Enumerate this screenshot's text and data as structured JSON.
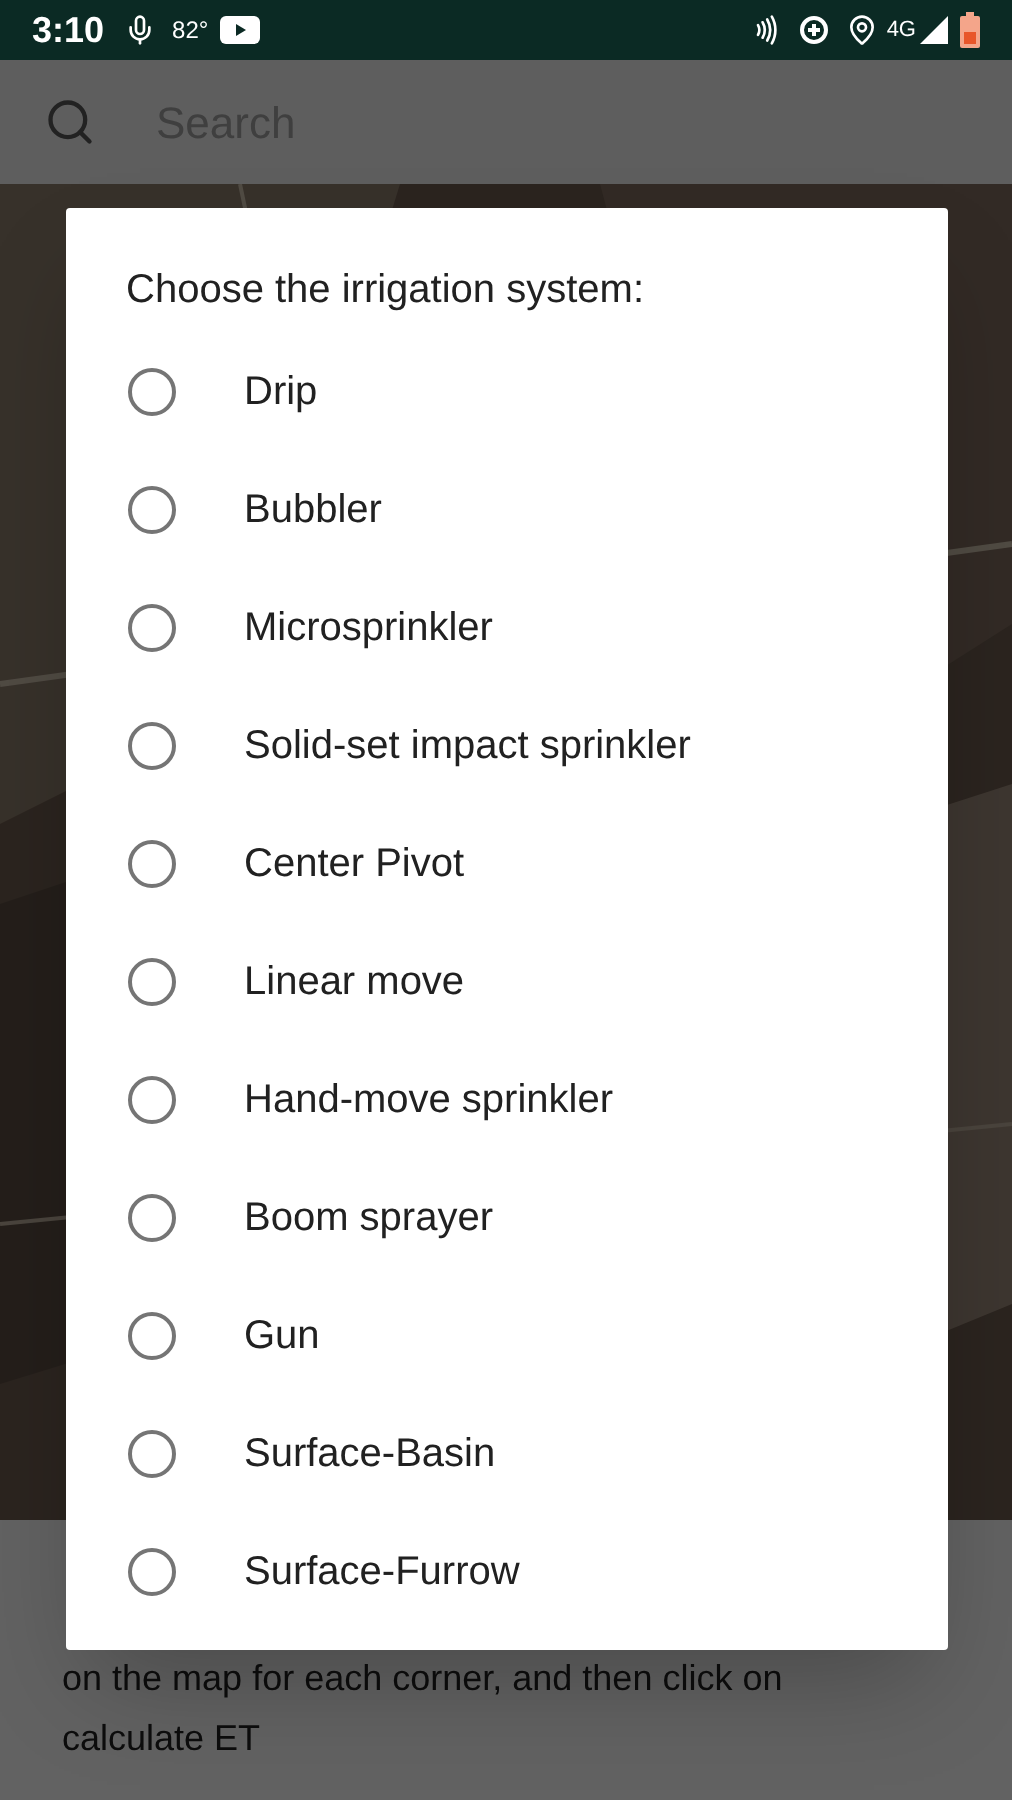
{
  "status_bar": {
    "time": "3:10",
    "temperature": "82°",
    "network": "4G"
  },
  "search": {
    "placeholder": "Search"
  },
  "instructions": "on the map for each corner, and then click on calculate ET",
  "dialog": {
    "title": "Choose the irrigation system:",
    "options": [
      {
        "label": "Drip",
        "selected": false
      },
      {
        "label": "Bubbler",
        "selected": false
      },
      {
        "label": "Microsprinkler",
        "selected": false
      },
      {
        "label": "Solid-set impact sprinkler",
        "selected": false
      },
      {
        "label": "Center Pivot",
        "selected": false
      },
      {
        "label": "Linear move",
        "selected": false
      },
      {
        "label": "Hand-move sprinkler",
        "selected": false
      },
      {
        "label": "Boom sprayer",
        "selected": false
      },
      {
        "label": "Gun",
        "selected": false
      },
      {
        "label": "Surface-Basin",
        "selected": false
      },
      {
        "label": "Surface-Furrow",
        "selected": false
      }
    ]
  }
}
